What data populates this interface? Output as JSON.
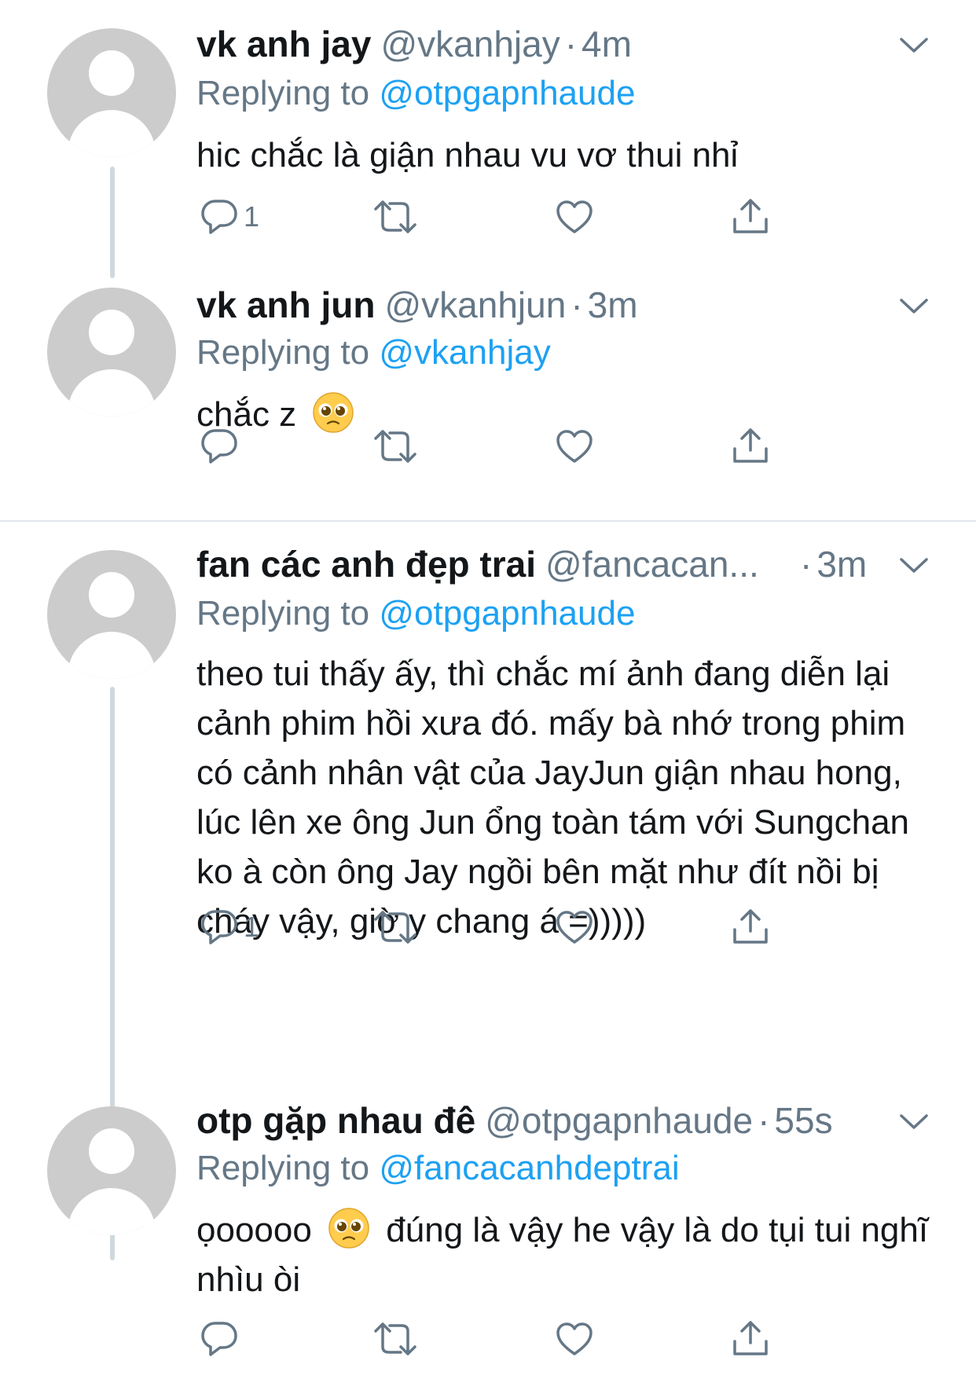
{
  "colors": {
    "link": "#1da1f2",
    "secondary_text": "#657786",
    "primary_text": "#14171a",
    "avatar_bg": "#cccccc",
    "thread_line": "#cfd9de",
    "divider": "#e1e8ed"
  },
  "icons": {
    "reply": "reply-icon",
    "retweet": "retweet-icon",
    "like": "heart-icon",
    "share": "share-icon",
    "more": "chevron-down-icon",
    "emoji": "pleading-face-emoji"
  },
  "tweets": [
    {
      "display_name": "vk anh jay",
      "handle": "@vkanhjay",
      "separator": "·",
      "time": "4m",
      "replying_prefix": "Replying to",
      "replying_to": "@otpgapnhaude",
      "text": "hic chắc là giận nhau vu vơ thui nhỉ",
      "reply_count": "1"
    },
    {
      "display_name": "vk anh jun",
      "handle": "@vkanhjun",
      "separator": "·",
      "time": "3m",
      "replying_prefix": "Replying to",
      "replying_to": "@vkanhjay",
      "text": "chắc z",
      "reply_count": ""
    },
    {
      "display_name": "fan các anh đẹp trai",
      "handle": "@fancacan...",
      "separator": "·",
      "time": "3m",
      "replying_prefix": "Replying to",
      "replying_to": "@otpgapnhaude",
      "text": "theo tui thấy ấy, thì chắc mí ảnh đang diễn lại cảnh phim hồi xưa đó. mấy bà nhớ trong phim có cảnh nhân vật của JayJun giận nhau hong, lúc lên xe ông Jun ổng toàn tám với Sungchan ko à còn ông Jay ngồi bên mặt như đít nồi bị cháy vậy, giờ y chang á =)))))",
      "reply_count": "1"
    },
    {
      "display_name": "otp gặp nhau đê",
      "handle": "@otpgapnhaude",
      "separator": "·",
      "time": "55s",
      "replying_prefix": "Replying to",
      "replying_to": "@fancacanhdeptrai",
      "text_before_emoji": "ọooooo",
      "text_after_emoji": "đúng là vậy he vậy là do tụi tui nghĩ nhìu òi",
      "reply_count": ""
    }
  ]
}
